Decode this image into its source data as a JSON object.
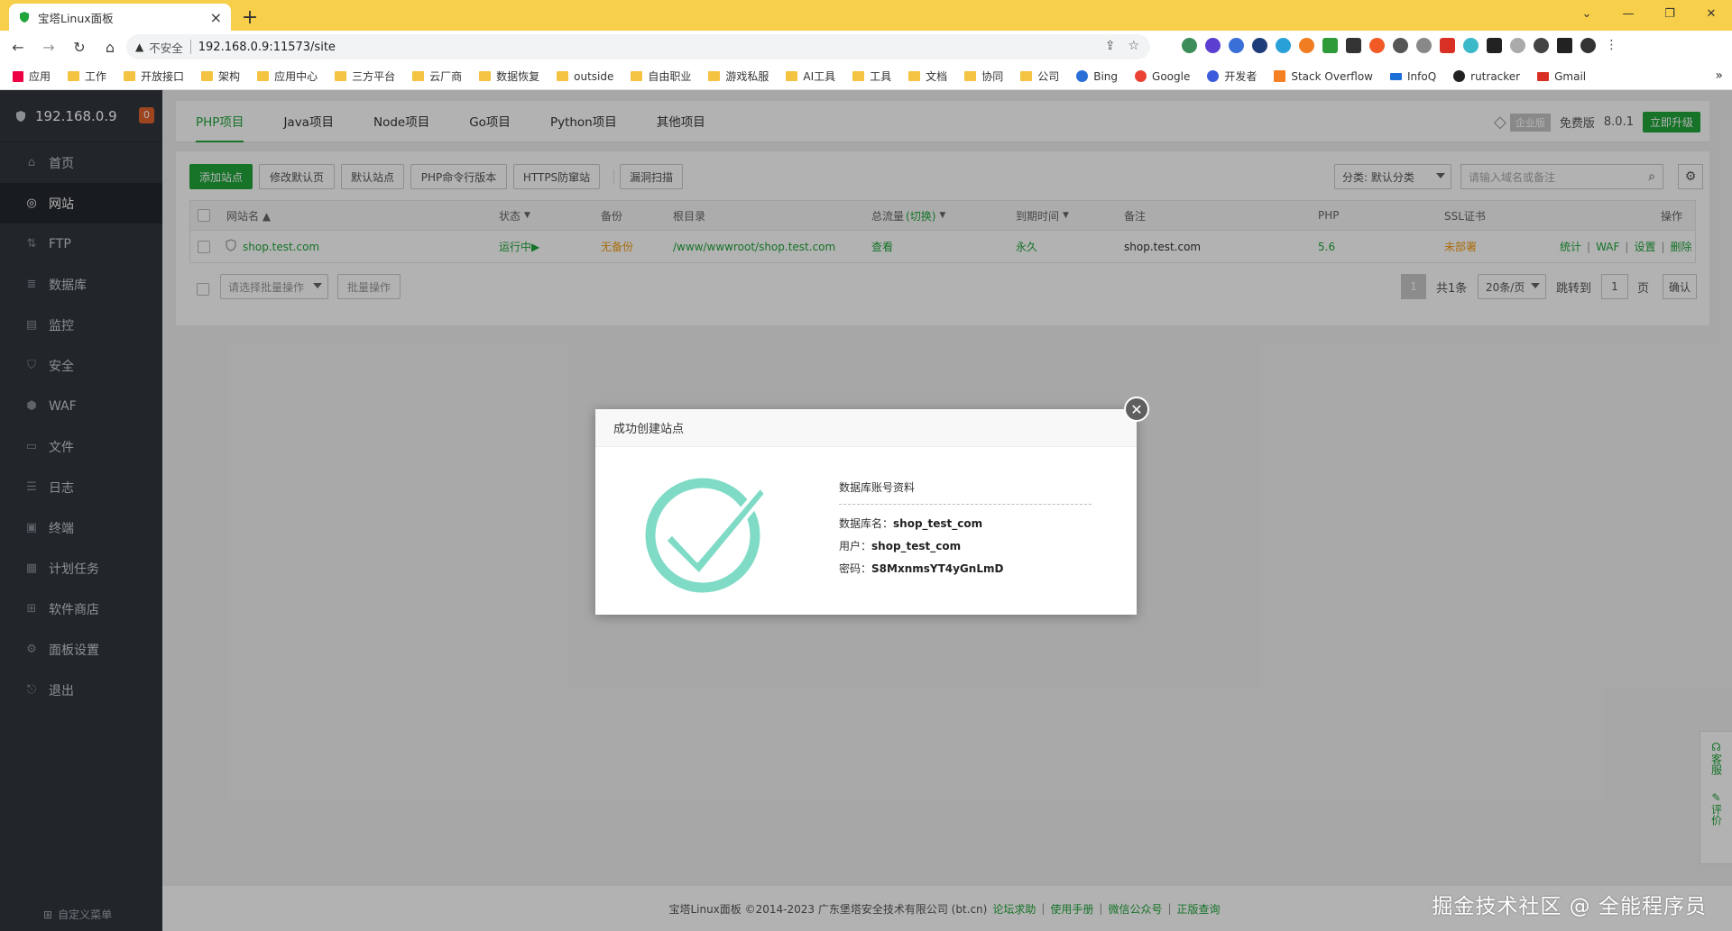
{
  "browser": {
    "tab_title": "宝塔Linux面板",
    "url_warning": "不安全",
    "url": "192.168.0.9:11573/site",
    "bookmarks": [
      "应用",
      "工作",
      "开放接口",
      "架构",
      "应用中心",
      "三方平台",
      "云厂商",
      "数据恢复",
      "outside",
      "自由职业",
      "游戏私服",
      "AI工具",
      "工具",
      "文档",
      "协同",
      "公司",
      "Bing",
      "Google",
      "开发者",
      "Stack Overflow",
      "InfoQ",
      "rutracker",
      "Gmail"
    ]
  },
  "sidebar": {
    "server": "192.168.0.9",
    "badge": "0",
    "items": [
      {
        "label": "首页",
        "icon": "home-icon"
      },
      {
        "label": "网站",
        "icon": "globe-icon"
      },
      {
        "label": "FTP",
        "icon": "ftp-icon"
      },
      {
        "label": "数据库",
        "icon": "database-icon"
      },
      {
        "label": "监控",
        "icon": "monitor-icon"
      },
      {
        "label": "安全",
        "icon": "shield-icon"
      },
      {
        "label": "WAF",
        "icon": "waf-icon"
      },
      {
        "label": "文件",
        "icon": "folder-icon"
      },
      {
        "label": "日志",
        "icon": "log-icon"
      },
      {
        "label": "终端",
        "icon": "terminal-icon"
      },
      {
        "label": "计划任务",
        "icon": "calendar-icon"
      },
      {
        "label": "软件商店",
        "icon": "grid-icon"
      },
      {
        "label": "面板设置",
        "icon": "settings-icon"
      },
      {
        "label": "退出",
        "icon": "logout-icon"
      }
    ],
    "active_index": 1,
    "footer": "自定义菜单"
  },
  "topnav": {
    "tabs": [
      "PHP项目",
      "Java项目",
      "Node项目",
      "Go项目",
      "Python项目",
      "其他项目"
    ],
    "active_index": 0,
    "edition": "企业版",
    "free": "免费版",
    "version": "8.0.1",
    "upgrade": "立即升级"
  },
  "toolbar": {
    "add_site": "添加站点",
    "edit_default": "修改默认页",
    "default_site": "默认站点",
    "php_cli": "PHP命令行版本",
    "https_guard": "HTTPS防窜站",
    "vuln_scan": "漏洞扫描",
    "category": "分类: 默认分类",
    "search_placeholder": "请输入域名或备注"
  },
  "table": {
    "headers": {
      "name": "网站名 ▲",
      "status": "状态",
      "backup": "备份",
      "root": "根目录",
      "traffic": "总流量",
      "traffic_switch": "(切换)",
      "expire": "到期时间",
      "remark": "备注",
      "php": "PHP",
      "ssl": "SSL证书",
      "ops": "操作"
    },
    "rows": [
      {
        "name": "shop.test.com",
        "status": "运行中▶",
        "backup": "无备份",
        "root": "/www/wwwroot/shop.test.com",
        "traffic": "查看",
        "expire": "永久",
        "remark": "shop.test.com",
        "php": "5.6",
        "ssl": "未部署",
        "ops": [
          "统计",
          "WAF",
          "设置",
          "删除"
        ]
      }
    ],
    "batch_select": "请选择批量操作",
    "batch_btn": "批量操作"
  },
  "pager": {
    "current": "1",
    "total": "共1条",
    "per_page": "20条/页",
    "jump_label": "跳转到",
    "jump_value": "1",
    "page_unit": "页",
    "confirm": "确认"
  },
  "footer": {
    "copyright": "宝塔Linux面板 ©2014-2023 广东堡塔安全技术有限公司 (bt.cn)",
    "links": [
      "论坛求助",
      "使用手册",
      "微信公众号",
      "正版查询"
    ]
  },
  "watermark": "掘金技术社区 @ 全能程序员",
  "sidetool": {
    "service": "客服",
    "review": "评价"
  },
  "modal": {
    "title": "成功创建站点",
    "db_title": "数据库账号资料",
    "db_name_label": "数据库名：",
    "db_name": "shop_test_com",
    "user_label": "用户：",
    "user": "shop_test_com",
    "pass_label": "密码：",
    "pass": "S8MxnmsYT4yGnLmD"
  },
  "colors": {
    "accent": "#20a53a",
    "warning": "#f39c12",
    "sidebar": "#31373e",
    "check": "#7fdbc6"
  }
}
